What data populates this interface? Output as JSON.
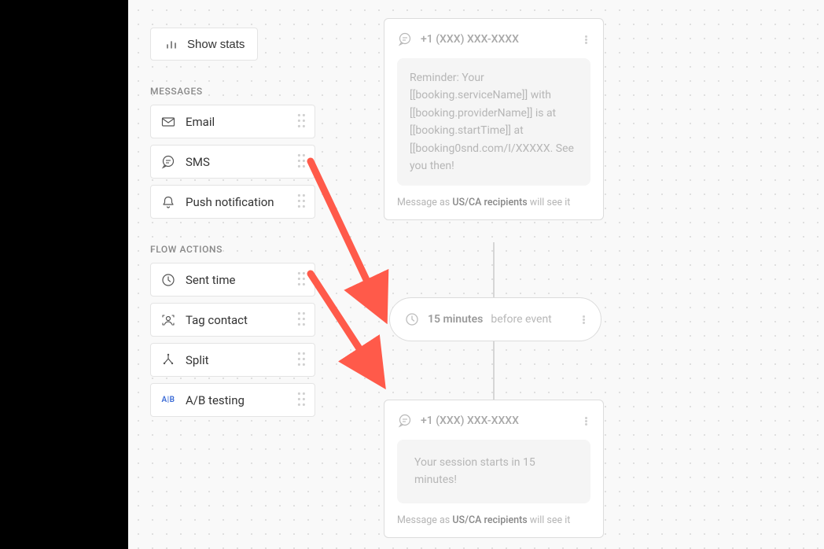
{
  "sidebar": {
    "show_stats": "Show stats",
    "section_messages": "MESSAGES",
    "section_flow_actions": "FLOW ACTIONS",
    "messages": [
      {
        "icon": "email-icon",
        "label": "Email"
      },
      {
        "icon": "sms-icon",
        "label": "SMS"
      },
      {
        "icon": "push-icon",
        "label": "Push notification"
      }
    ],
    "flow_actions": [
      {
        "icon": "clock-icon",
        "label": "Sent time"
      },
      {
        "icon": "tag-contact-icon",
        "label": "Tag contact"
      },
      {
        "icon": "split-icon",
        "label": "Split"
      },
      {
        "icon": "ab-testing-icon",
        "label": "A/B testing",
        "ab_text": "A|B"
      }
    ]
  },
  "cards": {
    "card1": {
      "phone": "+1 (XXX) XXX-XXXX",
      "message": "Reminder: Your [[booking.serviceName]] with [[booking.providerName]] is at [[booking.startTime]] at [[booking0snd.com/I/XXXXX. See you then!",
      "footer_prefix": "Message as ",
      "footer_strong": "US/CA recipients",
      "footer_suffix": " will see it"
    },
    "card2": {
      "phone": "+1 (XXX) XXX-XXXX",
      "message": "Your session starts in 15 minutes!",
      "footer_prefix": "Message as ",
      "footer_strong": "US/CA recipients",
      "footer_suffix": " will see it"
    }
  },
  "timing": {
    "strong": "15 minutes",
    "rest": "before event"
  }
}
